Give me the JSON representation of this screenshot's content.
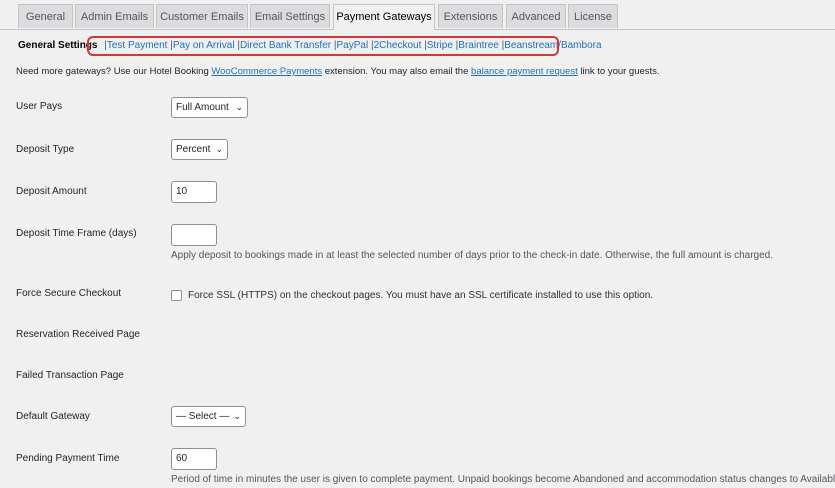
{
  "tabs": [
    {
      "label": "General"
    },
    {
      "label": "Admin Emails"
    },
    {
      "label": "Customer Emails"
    },
    {
      "label": "Email Settings"
    },
    {
      "label": "Payment Gateways",
      "active": true
    },
    {
      "label": "Extensions"
    },
    {
      "label": "Advanced"
    },
    {
      "label": "License"
    }
  ],
  "subnav": {
    "current": "General Settings",
    "separator": "|",
    "links": [
      "Test Payment",
      "Pay on Arrival",
      "Direct Bank Transfer",
      "PayPal",
      "2Checkout",
      "Stripe",
      "Braintree",
      "Beanstream/Bambora"
    ]
  },
  "notice": {
    "part1": "Need more gateways? Use our Hotel Booking ",
    "link1": "WooCommerce Payments",
    "part2": " extension. You may also email the ",
    "link2": "balance payment request",
    "part3": " link to your guests."
  },
  "fields": {
    "user_pays": {
      "label": "User Pays",
      "value": "Full Amount"
    },
    "deposit_type": {
      "label": "Deposit Type",
      "value": "Percent"
    },
    "deposit_amount": {
      "label": "Deposit Amount",
      "value": "10"
    },
    "deposit_time_frame": {
      "label": "Deposit Time Frame (days)",
      "value": "",
      "description": "Apply deposit to bookings made in at least the selected number of days prior to the check-in date. Otherwise, the full amount is charged."
    },
    "force_secure_checkout": {
      "label": "Force Secure Checkout",
      "checkbox_label": "Force SSL (HTTPS) on the checkout pages. You must have an SSL certificate installed to use this option.",
      "checked": false
    },
    "reservation_received_page": {
      "label": "Reservation Received Page"
    },
    "failed_transaction_page": {
      "label": "Failed Transaction Page"
    },
    "default_gateway": {
      "label": "Default Gateway",
      "value": "— Select —"
    },
    "pending_payment_time": {
      "label": "Pending Payment Time",
      "value": "60",
      "description": "Period of time in minutes the user is given to complete payment. Unpaid bookings become Abandoned and accommodation status changes to Available."
    }
  },
  "icons": {
    "select_chevron": "chevron-down-icon"
  },
  "colors": {
    "link": "#2271b1",
    "highlight_border": "#d63638",
    "background": "#f0f0f1"
  }
}
